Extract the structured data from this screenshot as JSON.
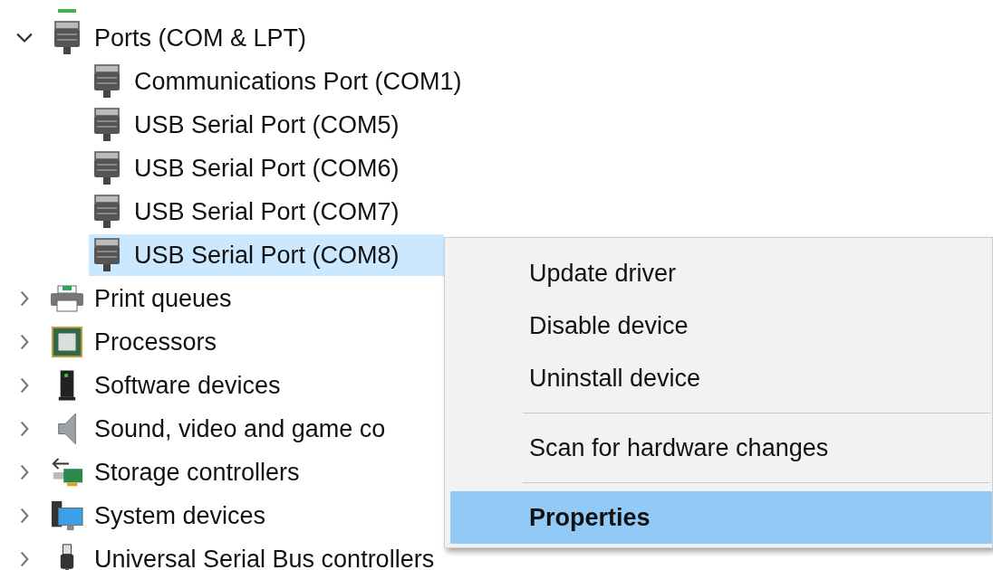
{
  "tree": [
    {
      "kind": "port",
      "label": "Ports (COM & LPT)",
      "expanded": true,
      "selected": false,
      "children": [
        {
          "kind": "port",
          "label": "Communications Port (COM1)",
          "selected": false
        },
        {
          "kind": "port",
          "label": "USB Serial Port (COM5)",
          "selected": false
        },
        {
          "kind": "port",
          "label": "USB Serial Port (COM6)",
          "selected": false
        },
        {
          "kind": "port",
          "label": "USB Serial Port (COM7)",
          "selected": false
        },
        {
          "kind": "port",
          "label": "USB Serial Port (COM8)",
          "selected": true
        }
      ]
    },
    {
      "kind": "printer",
      "label": "Print queues",
      "expanded": false,
      "selected": false
    },
    {
      "kind": "processor",
      "label": "Processors",
      "expanded": false,
      "selected": false
    },
    {
      "kind": "software",
      "label": "Software devices",
      "expanded": false,
      "selected": false
    },
    {
      "kind": "sound",
      "label": "Sound, video and game co",
      "expanded": false,
      "selected": false
    },
    {
      "kind": "storage",
      "label": "Storage controllers",
      "expanded": false,
      "selected": false
    },
    {
      "kind": "system",
      "label": "System devices",
      "expanded": false,
      "selected": false
    },
    {
      "kind": "usb",
      "label": "Universal Serial Bus controllers",
      "expanded": false,
      "selected": false
    }
  ],
  "context_menu": {
    "items": [
      {
        "kind": "item",
        "label": "Update driver",
        "selected": false
      },
      {
        "kind": "item",
        "label": "Disable device",
        "selected": false
      },
      {
        "kind": "item",
        "label": "Uninstall device",
        "selected": false
      },
      {
        "kind": "separator"
      },
      {
        "kind": "item",
        "label": "Scan for hardware changes",
        "selected": false
      },
      {
        "kind": "separator"
      },
      {
        "kind": "item",
        "label": "Properties",
        "selected": true
      }
    ]
  }
}
